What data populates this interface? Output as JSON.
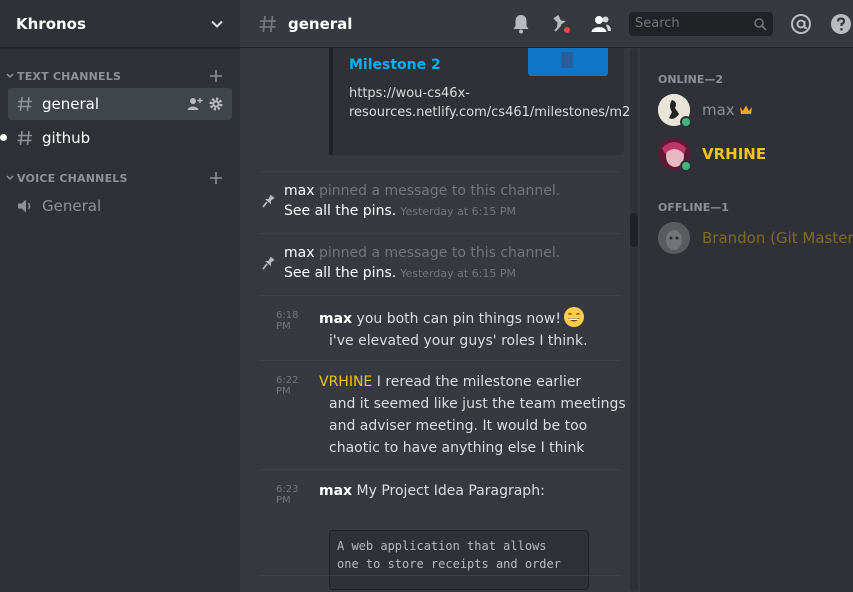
{
  "server": {
    "name": "Khronos"
  },
  "sidebar": {
    "categories": [
      {
        "label": "TEXT CHANNELS",
        "channels": [
          {
            "label": "general"
          },
          {
            "label": "github"
          }
        ]
      },
      {
        "label": "VOICE CHANNELS",
        "channels": [
          {
            "label": "General"
          }
        ]
      }
    ]
  },
  "header": {
    "channel": "general",
    "search_placeholder": "Search"
  },
  "embed": {
    "title": "Milestone 2",
    "url": "https://wou-cs46x-resources.netlify.com/cs461/milestones/m2"
  },
  "messages": [
    {
      "type": "pin",
      "author": "max",
      "text": " pinned a message to this channel.",
      "link": "See all the pins.",
      "time": "Yesterday at 6:15 PM"
    },
    {
      "type": "pin",
      "author": "max",
      "text": " pinned a message to this channel.",
      "link": "See all the pins.",
      "time": "Yesterday at 6:15 PM"
    },
    {
      "type": "msg",
      "time": "6:18 PM",
      "author": "max",
      "line1": "you both can pin things now!",
      "line2": "i've elevated your guys' roles I think."
    },
    {
      "type": "msg",
      "time": "6:22 PM",
      "author": "VRHINE",
      "line1": "I reread the milestone earlier",
      "line2": "and it seemed like just the team meetings",
      "line3": "and adviser meeting. It would be too",
      "line4": "chaotic to have anything else I think"
    },
    {
      "type": "msg",
      "time": "6:23 PM",
      "author": "max",
      "line1": "My Project Idea Paragraph:",
      "code1": "A web application that allows",
      "code2": "one to store receipts and order"
    }
  ],
  "members": {
    "online_header": "ONLINE—2",
    "offline_header": "OFFLINE—1",
    "online": [
      {
        "name": "max"
      },
      {
        "name": "VRHINE"
      }
    ],
    "offline": [
      {
        "name": "Brandon (Git Master)"
      }
    ]
  },
  "colors": {
    "accent_gold": "#f1c40f",
    "link_blue": "#00b0f4",
    "online_green": "#43b581",
    "mention_red": "#f04747"
  },
  "icons": [
    "chevron-down-icon",
    "hash-icon",
    "plus-icon",
    "add-member-icon",
    "gear-icon",
    "speaker-icon",
    "bell-icon",
    "pin-icon",
    "members-icon",
    "search-icon",
    "at-icon",
    "help-icon",
    "crown-icon",
    "grin-emoji"
  ]
}
